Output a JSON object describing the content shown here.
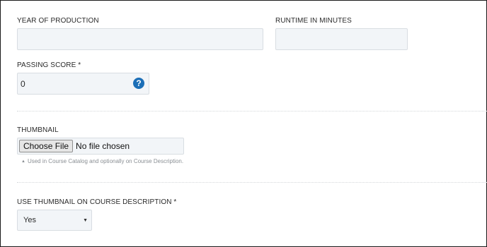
{
  "fields": {
    "year_of_production": {
      "label": "YEAR OF PRODUCTION",
      "value": ""
    },
    "runtime_in_minutes": {
      "label": "RUNTIME IN MINUTES",
      "value": ""
    },
    "passing_score": {
      "label": "PASSING SCORE *",
      "value": "0",
      "help_icon": "question-circle-icon",
      "help_glyph": "?"
    }
  },
  "thumbnail": {
    "label": "THUMBNAIL",
    "button_label": "Choose File",
    "status": "No file chosen",
    "hint_icon": "caret-up-icon",
    "hint_glyph": "▲",
    "hint": "Used in Course Catalog and optionally on Course Description."
  },
  "use_thumbnail": {
    "label": "USE THUMBNAIL ON COURSE DESCRIPTION *",
    "selected": "Yes",
    "arrow_glyph": "▼"
  },
  "colors": {
    "field_bg": "#f2f5f8",
    "field_border": "#d8dde2",
    "help_icon_bg": "#1c6fb7",
    "hint_text": "#8a8f94"
  }
}
